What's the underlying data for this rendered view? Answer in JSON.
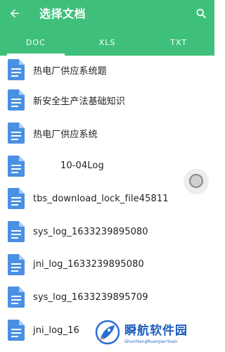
{
  "header": {
    "title": "选择文档",
    "back_icon": "arrow-left-icon",
    "search_icon": "search-icon",
    "background_color": "#3fc07a"
  },
  "tabs": [
    {
      "label": "DOC",
      "active": true
    },
    {
      "label": "XLS",
      "active": false
    },
    {
      "label": "TXT",
      "active": false
    }
  ],
  "files": [
    {
      "name": "热电厂供应系统题",
      "icon": "document-icon"
    },
    {
      "name": "新安全生产法基础知识",
      "icon": "document-icon"
    },
    {
      "name": "热电厂供应系统",
      "icon": "document-icon"
    },
    {
      "name": "10-04Log",
      "icon": "document-icon"
    },
    {
      "name": "tbs_download_lock_file45811",
      "icon": "document-icon"
    },
    {
      "name": "sys_log_1633239895080",
      "icon": "document-icon"
    },
    {
      "name": "jni_log_1633239895080",
      "icon": "document-icon"
    },
    {
      "name": "sys_log_1633239895709",
      "icon": "document-icon"
    },
    {
      "name": "jni_log_16",
      "icon": "document-icon"
    }
  ],
  "watermark": {
    "title": "瞬航软件园",
    "subtitle": "ShunHangRuanJianYuan"
  }
}
